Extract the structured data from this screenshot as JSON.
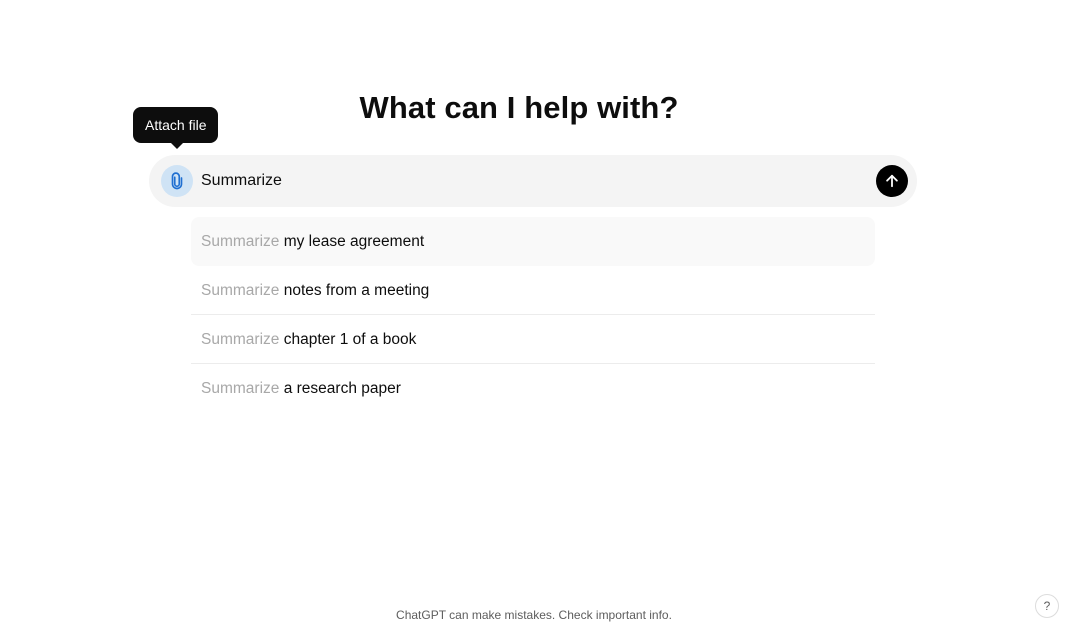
{
  "headline": "What can I help with?",
  "tooltip": {
    "text": "Attach file"
  },
  "composer": {
    "value": "Summarize",
    "attach_icon": "paperclip-icon",
    "send_icon": "arrow-up-icon"
  },
  "suggestions": [
    {
      "prefix": "Summarize",
      "rest": "my lease agreement"
    },
    {
      "prefix": "Summarize",
      "rest": "notes from a meeting"
    },
    {
      "prefix": "Summarize",
      "rest": "chapter 1 of a book"
    },
    {
      "prefix": "Summarize",
      "rest": "a research paper"
    }
  ],
  "footer": {
    "disclaimer": "ChatGPT can make mistakes. Check important info."
  },
  "help": {
    "label": "?"
  },
  "colors": {
    "composer_bg": "#f4f4f4",
    "attach_bg": "#cfe3f5",
    "attach_icon": "#1f6fd1",
    "send_bg": "#000000",
    "suggestion_prefix": "#a8a8a8",
    "text": "#0d0d0d"
  }
}
